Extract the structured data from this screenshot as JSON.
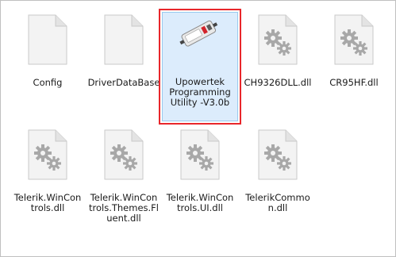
{
  "files": [
    {
      "label": "Config",
      "type": "blank"
    },
    {
      "label": "DriverDataBase",
      "type": "blank"
    },
    {
      "label": "Upowertek Programming Utility -V3.0b",
      "type": "app",
      "selected": true
    },
    {
      "label": "CH9326DLL.dll",
      "type": "dll"
    },
    {
      "label": "CR95HF.dll",
      "type": "dll"
    },
    {
      "label": "Telerik.WinControls.dll",
      "type": "dll"
    },
    {
      "label": "Telerik.WinControls.Themes.Fluent.dll",
      "type": "dll"
    },
    {
      "label": "Telerik.WinControls.UI.dll",
      "type": "dll"
    },
    {
      "label": "TelerikCommon.dll",
      "type": "dll"
    }
  ],
  "display": {
    "label_0": "Config",
    "label_1": "DriverDataBase",
    "label_2": "Upowertek Programming Utility -V3.0b",
    "label_3": "CH9326DLL.dll",
    "label_4": "CR95HF.dll",
    "label_5": "Telerik.WinControls.dll",
    "label_6": "Telerik.WinControls.Themes.Fluent.dll",
    "label_7": "Telerik.WinControls.UI.dll",
    "label_8": "TelerikCommon.dll"
  },
  "colors": {
    "selection_bg": "#dcecfc",
    "selection_border": "#99c9ef",
    "highlight_red": "#e8262b",
    "gear": "#a8a8a8"
  }
}
